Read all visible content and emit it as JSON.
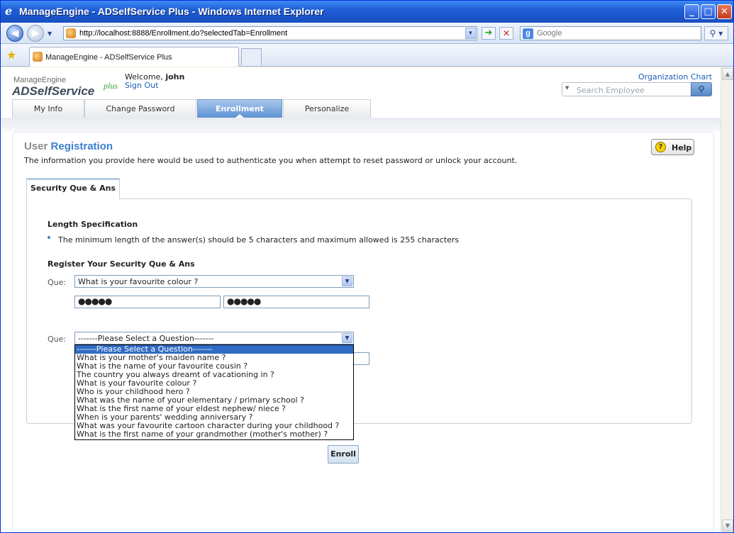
{
  "window": {
    "title": "ManageEngine - ADSelfService Plus - Windows Internet Explorer",
    "minimize": "_",
    "maximize": "□",
    "close": "✕"
  },
  "browser": {
    "url": "http://localhost:8888/Enrollment.do?selectedTab=Enrollment",
    "search_placeholder": "Google",
    "tab_title": "ManageEngine - ADSelfService Plus"
  },
  "app": {
    "logo_top": "ManageEngine",
    "logo_main": "ADSelfService",
    "logo_plus": "plus",
    "welcome_label": "Welcome,",
    "user": "john",
    "signout": "Sign Out",
    "org_chart": "Organization Chart",
    "search_employee_placeholder": "Search Employee",
    "tabs": [
      {
        "label": "My Info"
      },
      {
        "label": "Change Password"
      },
      {
        "label": "Enrollment"
      },
      {
        "label": "Personalize"
      }
    ],
    "active_tab": "Enrollment"
  },
  "page": {
    "title_grey": "User",
    "title_blue": "Registration",
    "help": "Help",
    "description": "The information you provide here would be used to authenticate you when attempt to reset password or unlock your account.",
    "subtab": "Security Que & Ans",
    "length_heading": "Length Specification",
    "length_text": "The minimum length of the answer(s) should be 5 characters and maximum allowed is 255 characters",
    "register_heading": "Register Your Security Que & Ans",
    "que_label": "Que:",
    "question1_value": "What is your favourite colour ?",
    "answer_mask": "●●●●●",
    "question2_value": "-------Please Select a Question-------",
    "enroll": "Enroll"
  },
  "dropdown": {
    "options": [
      "-------Please Select a Question-------",
      "What is your mother's maiden name ?",
      "What is the name of your favourite cousin ?",
      "The country you always dreamt of vacationing in ?",
      "What is your favourite colour ?",
      "Who is your childhood hero ?",
      "What was the name of your elementary / primary school ?",
      "What is the first name of your eldest nephew/ niece ?",
      "When is your parents' wedding anniversary ?",
      "What was your favourite cartoon character during your childhood ?",
      "What is the first name of your grandmother (mother's mother) ?"
    ],
    "selected_index": 0
  },
  "colors": {
    "accent_blue": "#3b7fcc",
    "titlebar": "#1f5fd8",
    "selection": "#316ac5"
  }
}
